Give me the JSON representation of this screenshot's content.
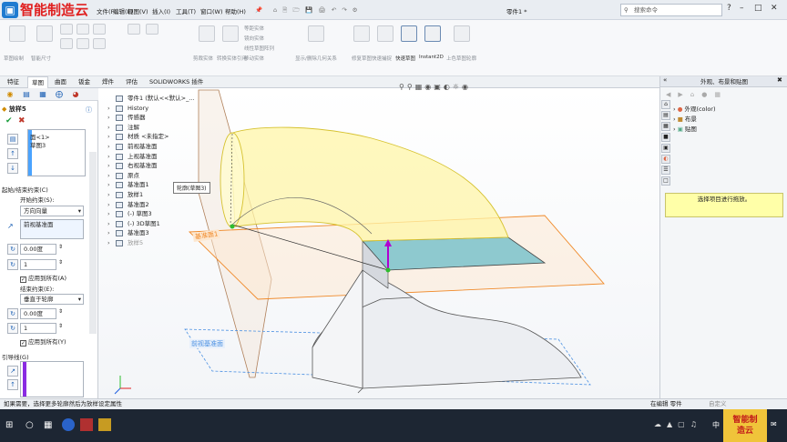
{
  "watermark": "智能制造云",
  "menu": {
    "file": "文件(F)",
    "edit": "编辑(E)",
    "view": "视图(V)",
    "insert": "插入(I)",
    "tools": "工具(T)",
    "window": "窗口(W)",
    "help": "帮助(H)"
  },
  "document_name": "零件1 *",
  "search_placeholder": "搜索命令",
  "ribbon": {
    "groups": [
      {
        "label": "草图绘制"
      },
      {
        "label": "智能尺寸"
      },
      {
        "label": "剪裁实体"
      },
      {
        "label": "转换实体引用"
      },
      {
        "label": "等距实体"
      },
      {
        "label": "镜向实体"
      },
      {
        "label": "线性草图阵列"
      },
      {
        "label": "移动实体"
      },
      {
        "label": "显示/删除几何关系"
      },
      {
        "label": "修复草图"
      },
      {
        "label": "快速捕捉"
      },
      {
        "label": "快速草图"
      },
      {
        "label": "Instant2D"
      },
      {
        "label": "上色草图轮廓"
      }
    ]
  },
  "tabs": [
    "特征",
    "草图",
    "曲面",
    "钣金",
    "焊件",
    "评估",
    "SOLIDWORKS 插件"
  ],
  "active_tab": "草图",
  "feature_panel": {
    "title": "放样5",
    "profiles": [
      "面<1>",
      "草图3"
    ],
    "section_constraints": "起始/结束约束(C)",
    "start_label": "开始约束(S):",
    "start_value": "方向向量",
    "start_ref": "前视基准面",
    "angle1": "0.00度",
    "length1": "1",
    "apply_all1": "应用到所有(A)",
    "end_label": "结束约束(E):",
    "end_value": "垂直于轮廓",
    "angle2": "0.00度",
    "length2": "1",
    "apply_all2": "应用到所有(Y)",
    "guide_label": "引导线(G)"
  },
  "tree": [
    {
      "label": "零件1 (默认<<默认>_..."
    },
    {
      "label": "History"
    },
    {
      "label": "传感器"
    },
    {
      "label": "注解"
    },
    {
      "label": "材质 <未指定>"
    },
    {
      "label": "前视基准面"
    },
    {
      "label": "上视基准面"
    },
    {
      "label": "右视基准面"
    },
    {
      "label": "原点"
    },
    {
      "label": "基准面1"
    },
    {
      "label": "放样1"
    },
    {
      "label": "基准面2"
    },
    {
      "label": "(-) 草图3"
    },
    {
      "label": "(-) 3D草图1"
    },
    {
      "label": "基准面3"
    },
    {
      "label": "放样5"
    }
  ],
  "callout": "轮廓(草图3)",
  "plane_labels": [
    "基准面1",
    "前视基准面"
  ],
  "task_panel": {
    "title": "外观、布景和贴图",
    "items": [
      "外观(color)",
      "布景",
      "贴图"
    ],
    "hint": "选择项目进行拖放。"
  },
  "status": {
    "message": "如果需要，选择更多轮廓然后为放样设定属性",
    "mode": "在编辑 零件",
    "units": "自定义"
  },
  "taskbar_brand": "智能制造云",
  "taskbar_ime": "中"
}
